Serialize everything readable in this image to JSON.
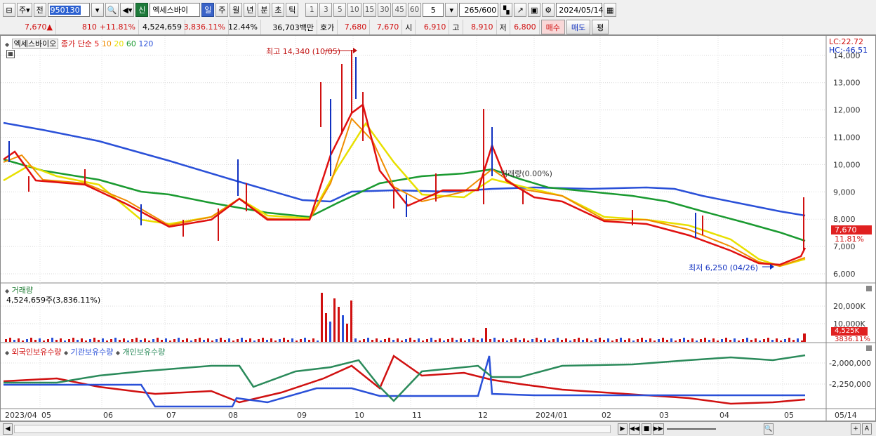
{
  "toolbar": {
    "period_type": "주",
    "period_prev": "전",
    "code": "950130",
    "badge_new": "신",
    "stock_name": "엑세스바이",
    "tab_day": "일",
    "tab_week": "주",
    "tab_month": "월",
    "tab_year": "년",
    "tab_minute": "분",
    "tab_second": "초",
    "tab_tick": "틱",
    "intervals": [
      "1",
      "3",
      "5",
      "10",
      "15",
      "30",
      "45",
      "60"
    ],
    "interval_value": "5",
    "count": "265",
    "count_total": "/600",
    "date": "2024/05/14"
  },
  "quote": {
    "price": "7,670",
    "arrow": "▲",
    "change": "810",
    "change_pct": "+11.81%",
    "volume": "4,524,659",
    "volume_ratio": "3,836.11%",
    "turnover": "12.44%",
    "amount": "36,703백만",
    "hoga_label": "호가",
    "hoga_ask": "7,680",
    "hoga_bid": "7,670",
    "open_label": "시",
    "open": "6,910",
    "high_label": "고",
    "high": "8,910",
    "low_label": "저",
    "low": "6,800",
    "buy_button": "매수",
    "sell_button": "매도",
    "eval_button": "평"
  },
  "price_panel": {
    "title": "엑세스바이오",
    "legend_label": "종가 단순",
    "ma": [
      {
        "period": "5",
        "color": "#e01010"
      },
      {
        "period": "10",
        "color": "#f08c00"
      },
      {
        "period": "20",
        "color": "#e8e000"
      },
      {
        "period": "60",
        "color": "#1a9a30"
      },
      {
        "period": "120",
        "color": "#2a50d8"
      }
    ],
    "lc": "LC:22.72",
    "hc": "HC:-46.51",
    "axis": [
      "14,000",
      "13,000",
      "12,000",
      "11,000",
      "10,000",
      "9,000",
      "8,000",
      "7,000",
      "6,000"
    ],
    "current_price_box": "7,670",
    "current_pct": "11.81%",
    "annot_high": "최고 14,340 (10/05)",
    "annot_low": "최저 6,250 (04/26)",
    "annot_vol": "거래량(0.00%)"
  },
  "volume_panel": {
    "title": "거래량",
    "value": "4,524,659주(3,836.11%)",
    "axis": [
      "20,000K",
      "10,000K"
    ],
    "current_box": "4,525K",
    "current_pct": "3836.11%"
  },
  "holding_panel": {
    "legend": [
      "외국인보유수량",
      "기관보유수량",
      "개인보유수량"
    ],
    "colors": [
      "#d01010",
      "#2a50d8",
      "#2a8a5a"
    ],
    "axis": [
      "-2,000,000",
      "-2,250,000"
    ]
  },
  "x_axis": [
    "2023/04",
    "05",
    "06",
    "07",
    "08",
    "09",
    "10",
    "11",
    "12",
    "2024/01",
    "02",
    "03",
    "04",
    "05",
    "05/14"
  ]
}
